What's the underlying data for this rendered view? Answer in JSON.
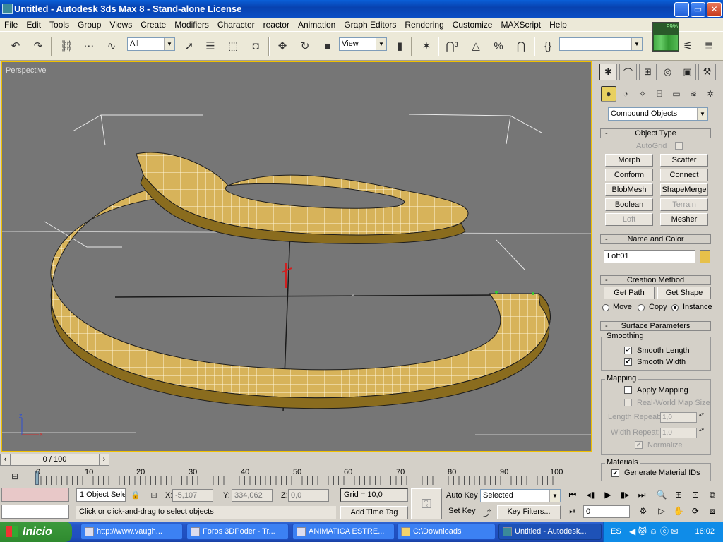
{
  "window": {
    "title": "Untitled - Autodesk 3ds Max 8  - Stand-alone License",
    "controls": [
      "_",
      "▭",
      "✕"
    ]
  },
  "menu": [
    "File",
    "Edit",
    "Tools",
    "Group",
    "Views",
    "Create",
    "Modifiers",
    "Character",
    "reactor",
    "Animation",
    "Graph Editors",
    "Rendering",
    "Customize",
    "MAXScript",
    "Help"
  ],
  "toolbar": {
    "selection_filter": "All",
    "ref_coord": "View",
    "named_selection": "",
    "memory_graph": "99%"
  },
  "viewport": {
    "label": "Perspective",
    "axis_labels": {
      "x": "x",
      "y": "y",
      "z": "z"
    }
  },
  "command_panel": {
    "category": "Compound Objects",
    "object_type": {
      "title": "Object Type",
      "autogrid": "AutoGrid",
      "buttons": [
        [
          "Morph",
          "Scatter"
        ],
        [
          "Conform",
          "Connect"
        ],
        [
          "BlobMesh",
          "ShapeMerge"
        ],
        [
          "Boolean",
          "Terrain"
        ],
        [
          "Loft",
          "Mesher"
        ]
      ]
    },
    "name_color": {
      "title": "Name and Color",
      "name": "Loft01",
      "color": "#e6c04a"
    },
    "creation_method": {
      "title": "Creation Method",
      "get_path": "Get Path",
      "get_shape": "Get Shape",
      "move": "Move",
      "copy": "Copy",
      "instance": "Instance",
      "selected": "Instance"
    },
    "surface_params": {
      "title": "Surface Parameters",
      "smoothing_label": "Smoothing",
      "smooth_length": "Smooth Length",
      "smooth_width": "Smooth Width",
      "mapping_label": "Mapping",
      "apply_mapping": "Apply Mapping",
      "real_world": "Real-World Map Size",
      "length_repeat_label": "Length Repeat:",
      "length_repeat": "1,0",
      "width_repeat_label": "Width Repeat:",
      "width_repeat": "1,0",
      "normalize": "Normalize",
      "materials_label": "Materials",
      "gen_mat_ids": "Generate Material IDs"
    }
  },
  "timeline": {
    "slider": "0 / 100",
    "ticks": [
      "0",
      "10",
      "20",
      "30",
      "40",
      "50",
      "60",
      "70",
      "80",
      "90",
      "100"
    ]
  },
  "status": {
    "objects": "1 Object Sele",
    "x_label": "X:",
    "x": "-5,107",
    "y_label": "Y:",
    "y": "334,062",
    "z_label": "Z:",
    "z": "0,0",
    "grid": "Grid = 10,0",
    "prompt": "Click or click-and-drag to select objects",
    "add_time_tag": "Add Time Tag",
    "auto_key": "Auto Key",
    "set_key": "Set Key",
    "key_mode": "Selected",
    "key_filters": "Key Filters...",
    "frame": "0"
  },
  "taskbar": {
    "start": "Inicio",
    "tasks": [
      "http://www.vaugh...",
      "Foros 3DPoder - Tr...",
      "ANIMATICA ESTRE...",
      "C:\\Downloads",
      "Untitled - Autodesk..."
    ],
    "lang": "ES",
    "clock": "16:02"
  }
}
